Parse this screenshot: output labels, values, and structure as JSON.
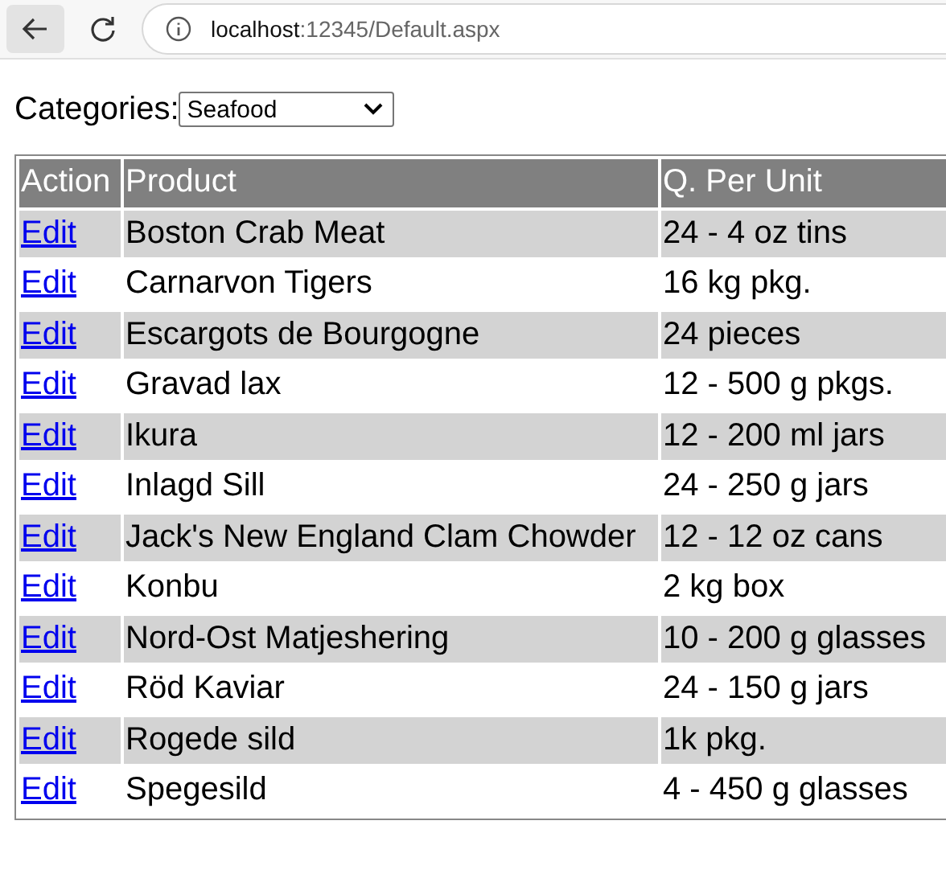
{
  "browser": {
    "url_host": "localhost",
    "url_path": ":12345/Default.aspx"
  },
  "filter": {
    "label": "Categories:",
    "value": "Seafood"
  },
  "table": {
    "columns": [
      "Action",
      "Product",
      "Q. Per Unit"
    ],
    "rows": [
      {
        "action": "Edit",
        "product": "Boston Crab Meat",
        "quantity": "24 - 4 oz tins"
      },
      {
        "action": "Edit",
        "product": "Carnarvon Tigers",
        "quantity": "16 kg pkg."
      },
      {
        "action": "Edit",
        "product": "Escargots de Bourgogne",
        "quantity": "24 pieces"
      },
      {
        "action": "Edit",
        "product": "Gravad lax",
        "quantity": "12 - 500 g pkgs."
      },
      {
        "action": "Edit",
        "product": "Ikura",
        "quantity": "12 - 200 ml jars"
      },
      {
        "action": "Edit",
        "product": "Inlagd Sill",
        "quantity": "24 - 250 g jars"
      },
      {
        "action": "Edit",
        "product": "Jack's New England Clam Chowder",
        "quantity": "12 - 12 oz cans"
      },
      {
        "action": "Edit",
        "product": "Konbu",
        "quantity": "2 kg box"
      },
      {
        "action": "Edit",
        "product": "Nord-Ost Matjeshering",
        "quantity": "10 - 200 g glasses"
      },
      {
        "action": "Edit",
        "product": "Röd Kaviar",
        "quantity": "24 - 150 g jars"
      },
      {
        "action": "Edit",
        "product": "Rogede sild",
        "quantity": "1k pkg."
      },
      {
        "action": "Edit",
        "product": "Spegesild",
        "quantity": "4 - 450 g glasses"
      }
    ]
  }
}
